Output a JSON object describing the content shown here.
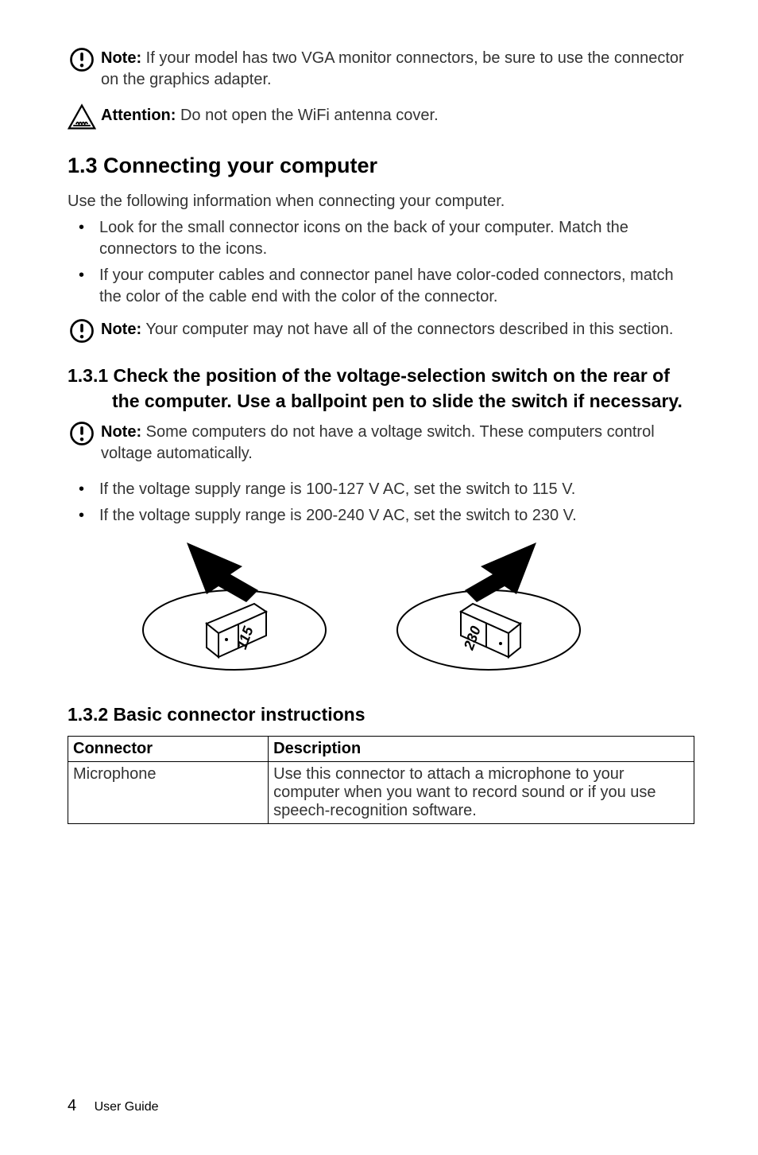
{
  "note1": {
    "label": "Note:",
    "text": "If your model has two VGA monitor connectors, be sure to use the connector on the graphics adapter."
  },
  "attention1": {
    "label": "Attention:",
    "text": "Do not open the WiFi antenna cover."
  },
  "section_heading": "1.3  Connecting your computer",
  "intro_text": "Use the following information when connecting your computer.",
  "bullets1": [
    "Look for the small connector icons on the back of your computer. Match the connectors to the icons.",
    "If your computer cables and connector panel have color-coded connectors, match the color of the cable end with the color of the connector."
  ],
  "note2": {
    "label": "Note:",
    "text": "Your computer may not have all of the connectors described in this section."
  },
  "subsection1_heading": "1.3.1 Check the position of the voltage-selection switch on the rear of the computer. Use a ballpoint pen to slide the switch if necessary.",
  "note3": {
    "label": "Note:",
    "text": "Some computers do not have a voltage switch. These computers control voltage automatically."
  },
  "bullets2": [
    "If the voltage supply range is 100-127 V AC, set the switch to 115 V.",
    "If the voltage supply range is 200-240 V AC, set the switch to 230 V."
  ],
  "figure": {
    "left_label": "115",
    "right_label": "230"
  },
  "subsection2_heading": "1.3.2 Basic connector instructions",
  "table": {
    "headers": [
      "Connector",
      "Description"
    ],
    "rows": [
      {
        "connector": "Microphone",
        "description": "Use this connector to attach a microphone to your computer when you want to record sound or if you use speech-recognition software."
      }
    ]
  },
  "footer": {
    "page_number": "4",
    "label": "User Guide"
  }
}
